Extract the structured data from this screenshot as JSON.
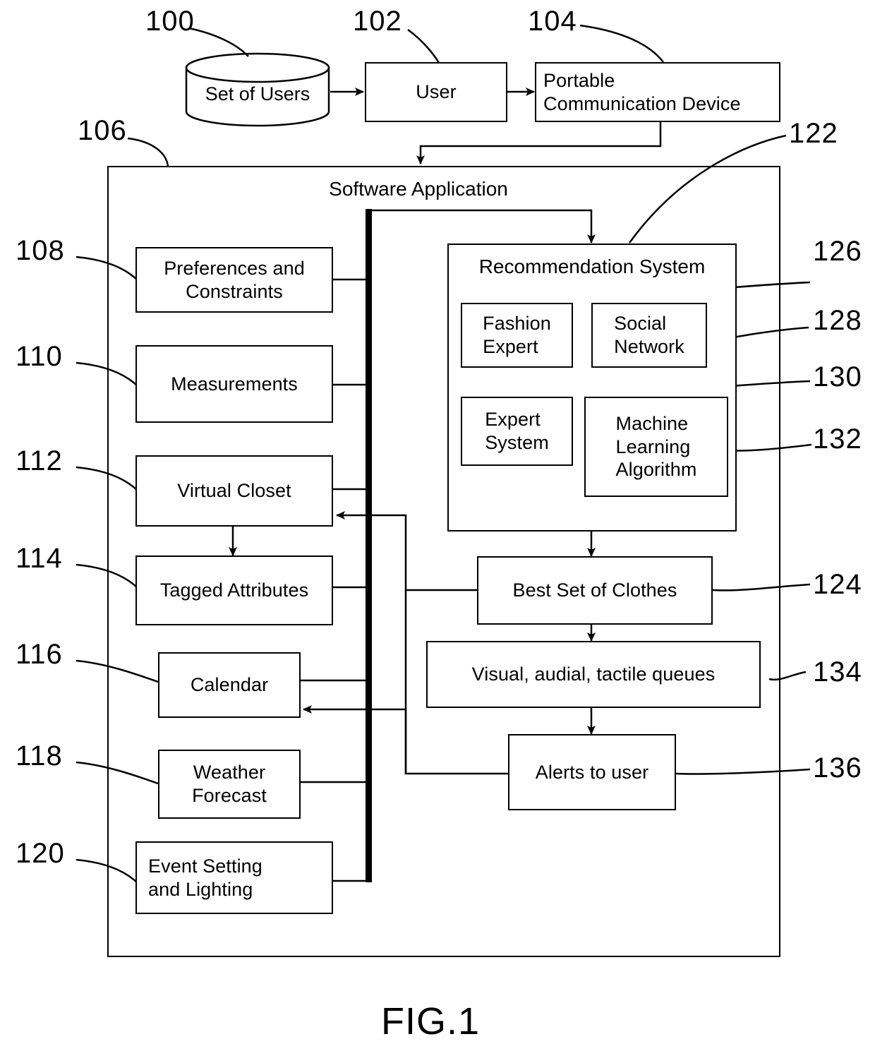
{
  "figure": {
    "label": "FIG.1",
    "title": "Software Application"
  },
  "top_row": {
    "set_of_users": "Set of Users",
    "user": "User",
    "portable_device": "Portable\nCommunication Device"
  },
  "inputs": [
    {
      "ref": "108",
      "label": "Preferences and Constraints"
    },
    {
      "ref": "110",
      "label": "Measurements"
    },
    {
      "ref": "112",
      "label": "Virtual Closet"
    },
    {
      "ref": "114",
      "label": "Tagged Attributes"
    },
    {
      "ref": "116",
      "label": "Calendar"
    },
    {
      "ref": "118",
      "label": "Weather Forecast"
    },
    {
      "ref": "120",
      "label": "Event Setting and Lighting"
    }
  ],
  "recommendation_system": {
    "title": "Recommendation System",
    "ref": "122",
    "components": [
      {
        "ref": "126",
        "label": "Fashion Expert"
      },
      {
        "ref": "128",
        "label": "Social Network"
      },
      {
        "ref": "130",
        "label": "Expert System"
      },
      {
        "ref": "132",
        "label": "Machine Learning Algorithm"
      }
    ]
  },
  "outputs": [
    {
      "ref": "124",
      "label": "Best Set of Clothes"
    },
    {
      "ref": "134",
      "label": "Visual, audial, tactile queues"
    },
    {
      "ref": "136",
      "label": "Alerts to user"
    }
  ],
  "refs": {
    "set_of_users": "100",
    "user": "102",
    "portable_device": "104",
    "software_application": "106"
  },
  "box_text": {
    "preferences_line1": "Preferences and",
    "preferences_line2": "Constraints",
    "measurements": "Measurements",
    "virtual_closet": "Virtual Closet",
    "tagged_attributes": "Tagged Attributes",
    "calendar": "Calendar",
    "weather_line1": "Weather",
    "weather_line2": "Forecast",
    "event_line1": "Event Setting",
    "event_line2": "and Lighting",
    "fashion_line1": "Fashion",
    "fashion_line2": "Expert",
    "social_line1": "Social",
    "social_line2": "Network",
    "expert_line1": "Expert",
    "expert_line2": "System",
    "ml_line1": "Machine",
    "ml_line2": "Learning",
    "ml_line3": "Algorithm",
    "best_set": "Best Set of Clothes",
    "queues": "Visual, audial, tactile queues",
    "alerts": "Alerts to user",
    "set_of_users": "Set of Users",
    "user": "User",
    "portable_line1": "Portable",
    "portable_line2": "Communication Device",
    "recommendation_system": "Recommendation System"
  },
  "colors": {
    "stroke": "#000000",
    "background": "#ffffff"
  }
}
